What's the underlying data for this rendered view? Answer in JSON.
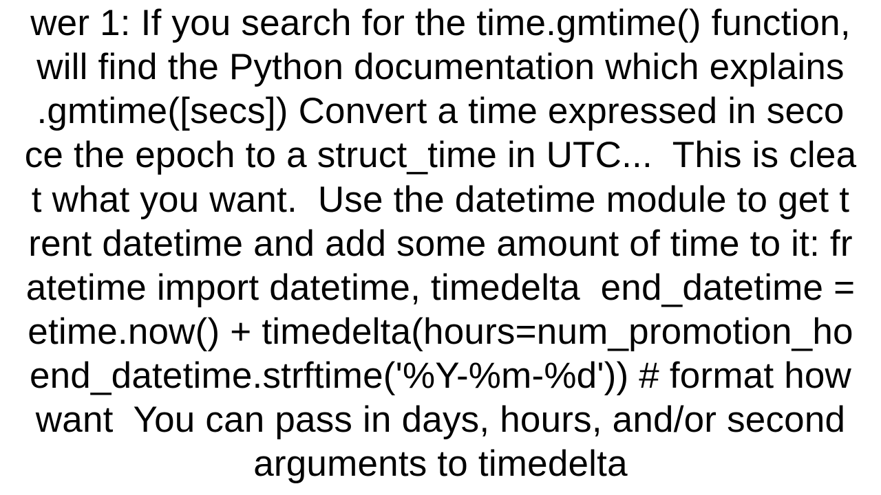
{
  "answer": {
    "lines": [
      "wer 1: If you search for the time.gmtime() function,",
      "will find the Python documentation which explains",
      ".gmtime([secs]) Convert a time expressed in seco",
      "ce the epoch to a struct_time in UTC...  This is clea",
      "t what you want.  Use the datetime module to get t",
      "rent datetime and add some amount of time to it: fr",
      "atetime import datetime, timedelta  end_datetime =",
      "etime.now() + timedelta(hours=num_promotion_ho",
      "end_datetime.strftime('%Y-%m-%d')) # format how",
      "want  You can pass in days, hours, and/or second",
      "arguments to timedelta"
    ]
  }
}
